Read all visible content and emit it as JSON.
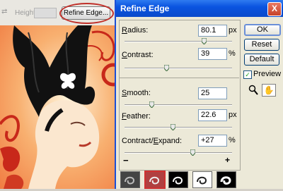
{
  "options_bar": {
    "height_label": "Height:",
    "refine_button_label": "Refine Edge..."
  },
  "dialog": {
    "title": "Refine Edge",
    "close_label": "X",
    "fields": [
      {
        "label_pre": "",
        "label_accel": "R",
        "label_post": "adius:",
        "value": "80.1",
        "unit": "px",
        "slider": 0.74
      },
      {
        "label_pre": "",
        "label_accel": "C",
        "label_post": "ontrast:",
        "value": "39",
        "unit": "%",
        "slider": 0.39
      },
      {
        "label_pre": "",
        "label_accel": "S",
        "label_post": "mooth:",
        "value": "25",
        "unit": "",
        "slider": 0.25
      },
      {
        "label_pre": "",
        "label_accel": "F",
        "label_post": "eather:",
        "value": "22.6",
        "unit": "px",
        "slider": 0.45
      },
      {
        "label_pre": "Contract/",
        "label_accel": "E",
        "label_post": "xpand:",
        "value": "+27",
        "unit": "%",
        "slider": 0.635
      }
    ],
    "minus_label": "−",
    "plus_label": "+",
    "buttons": {
      "ok": "OK",
      "reset": "Reset",
      "default": "Default"
    },
    "preview_label": "Preview",
    "preview_checked": true,
    "preview_check": "✓",
    "hand_icon": "✋"
  },
  "colors": {
    "title_bar": "#0a54e0",
    "close_button": "#c6422a",
    "selected_thumbnail": "#d03030",
    "red_circle": "#c0302a"
  }
}
